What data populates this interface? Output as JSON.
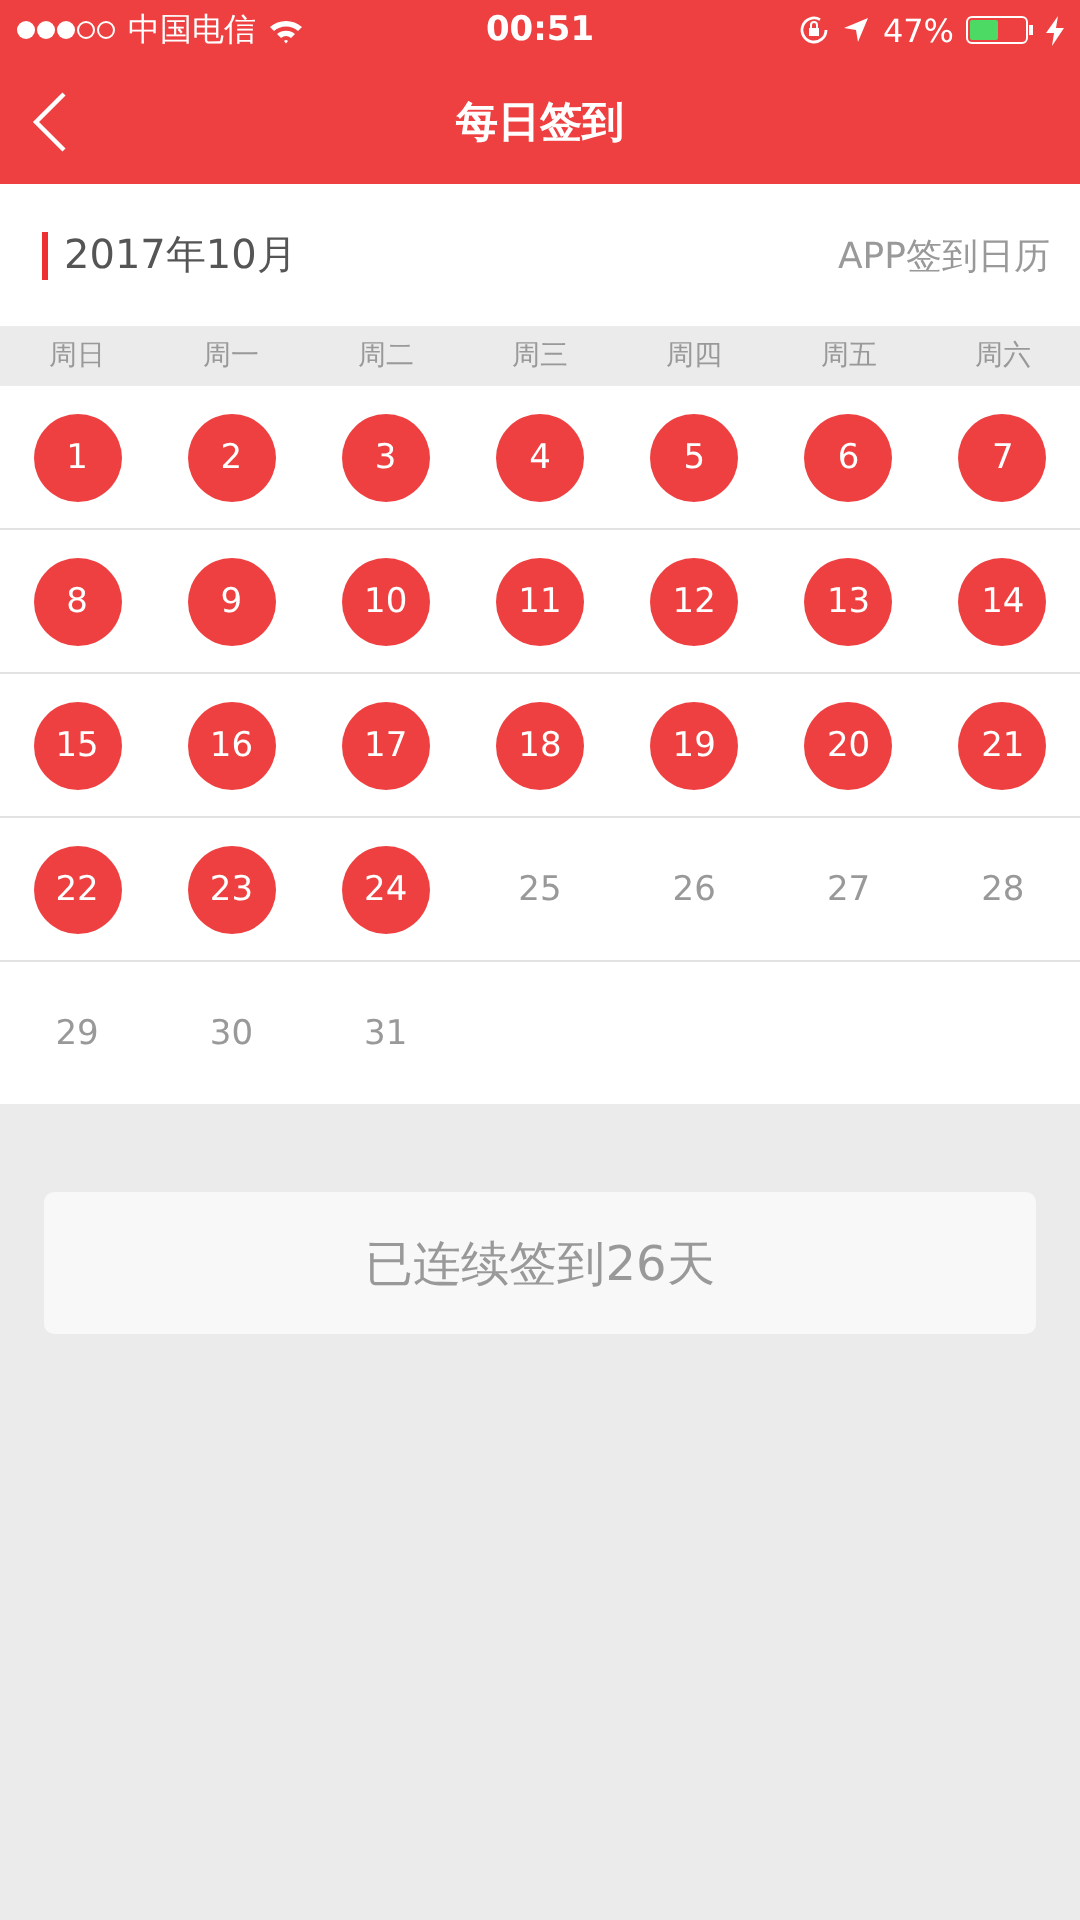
{
  "status_bar": {
    "carrier": "中国电信",
    "time": "00:51",
    "battery": "47%"
  },
  "header": {
    "title": "每日签到"
  },
  "month": {
    "title": "2017年10月",
    "link": "APP签到日历"
  },
  "weekdays": [
    "周日",
    "周一",
    "周二",
    "周三",
    "周四",
    "周五",
    "周六"
  ],
  "weeks": [
    [
      {
        "day": "1",
        "signed": true
      },
      {
        "day": "2",
        "signed": true
      },
      {
        "day": "3",
        "signed": true
      },
      {
        "day": "4",
        "signed": true
      },
      {
        "day": "5",
        "signed": true
      },
      {
        "day": "6",
        "signed": true
      },
      {
        "day": "7",
        "signed": true
      }
    ],
    [
      {
        "day": "8",
        "signed": true
      },
      {
        "day": "9",
        "signed": true
      },
      {
        "day": "10",
        "signed": true
      },
      {
        "day": "11",
        "signed": true
      },
      {
        "day": "12",
        "signed": true
      },
      {
        "day": "13",
        "signed": true
      },
      {
        "day": "14",
        "signed": true
      }
    ],
    [
      {
        "day": "15",
        "signed": true
      },
      {
        "day": "16",
        "signed": true
      },
      {
        "day": "17",
        "signed": true
      },
      {
        "day": "18",
        "signed": true
      },
      {
        "day": "19",
        "signed": true
      },
      {
        "day": "20",
        "signed": true
      },
      {
        "day": "21",
        "signed": true
      }
    ],
    [
      {
        "day": "22",
        "signed": true
      },
      {
        "day": "23",
        "signed": true
      },
      {
        "day": "24",
        "signed": true
      },
      {
        "day": "25",
        "signed": false
      },
      {
        "day": "26",
        "signed": false
      },
      {
        "day": "27",
        "signed": false
      },
      {
        "day": "28",
        "signed": false
      }
    ],
    [
      {
        "day": "29",
        "signed": false
      },
      {
        "day": "30",
        "signed": false
      },
      {
        "day": "31",
        "signed": false
      }
    ]
  ],
  "streak_button": "已连续签到26天"
}
